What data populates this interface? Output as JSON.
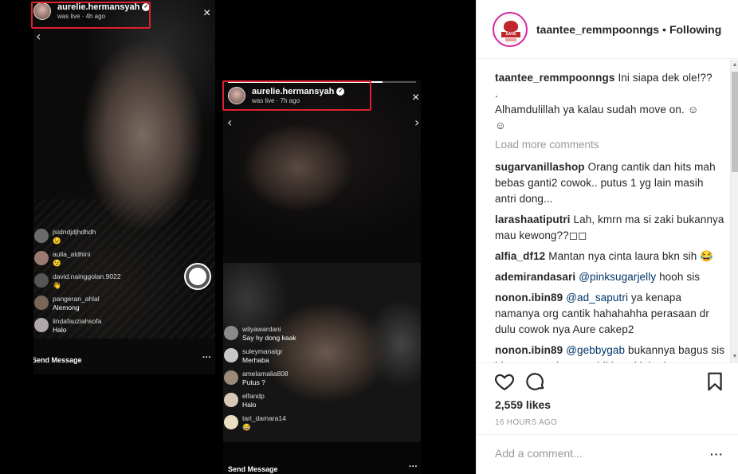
{
  "live1": {
    "username": "aurelie.hermansyah",
    "status": "was live · 4h ago",
    "comments": [
      {
        "name": "jsidndjdjhdhdh",
        "text": "😉"
      },
      {
        "name": "aulia_aldhini",
        "text": "😉"
      },
      {
        "name": "david.nainggolan.9022",
        "text": "👋"
      },
      {
        "name": "pangeran_ahlal",
        "text": "Alemong"
      },
      {
        "name": "lindafauziahsofa",
        "text": "Halo"
      }
    ],
    "send_label": "Send Message"
  },
  "live2": {
    "username": "aurelie.hermansyah",
    "status": "was live · 7h ago",
    "comments": [
      {
        "name": "wilyawardani",
        "text": "Say hy dong kaak"
      },
      {
        "name": "suleymanalgr",
        "text": "Merhaba"
      },
      {
        "name": "amelamalia808",
        "text": "Putus ?"
      },
      {
        "name": "elfandp",
        "text": "Halo"
      },
      {
        "name": "tari_damara14",
        "text": "😂"
      }
    ],
    "send_label": "Send Message"
  },
  "icons": {
    "close": "×",
    "chevron_left": "‹",
    "chevron_right": "›",
    "verified": "✓",
    "more": "···"
  },
  "header": {
    "username": "taantee_remmpoonngs",
    "separator": "•",
    "follow_status": "Following",
    "logo_text": "SAVE"
  },
  "caption": {
    "username": "taantee_remmpoonngs",
    "line1": "Ini siapa dek ole!??",
    "line2": ".",
    "line3": "Alhamdulillah ya kalau sudah move on. ☺",
    "line4": "☺"
  },
  "load_more": "Load more comments",
  "comments": [
    {
      "user": "sugarvanillashop",
      "text": "Orang cantik dan hits mah bebas ganti2 cowok.. putus 1 yg lain masih antri dong..."
    },
    {
      "user": "larashaatiputri",
      "text": "Lah, kmrn ma si zaki bukannya mau kewong??◻◻"
    },
    {
      "user": "alfia_df12",
      "text": "Mantan nya cinta laura bkn sih 😂"
    },
    {
      "user": "ademirandasari",
      "mention": "@pinksugarjelly",
      "text": "hooh sis"
    },
    {
      "user": "nonon.ibin89",
      "mention": "@ad_saputri",
      "text": "ya kenapa namanya org cantik hahahahha perasaan dr dulu cowok nya Aure cakep2"
    },
    {
      "user": "nonon.ibin89",
      "mention": "@gebbygab",
      "text": "bukannya bagus sis jd ga terpuruk sm yg bikin sakit hati"
    }
  ],
  "likes": "2,559 likes",
  "post_time": "16 HOURS AGO",
  "add_comment": {
    "placeholder": "Add a comment...",
    "more": "···"
  },
  "scrollbar": {
    "up": "▲",
    "down": "▼"
  }
}
